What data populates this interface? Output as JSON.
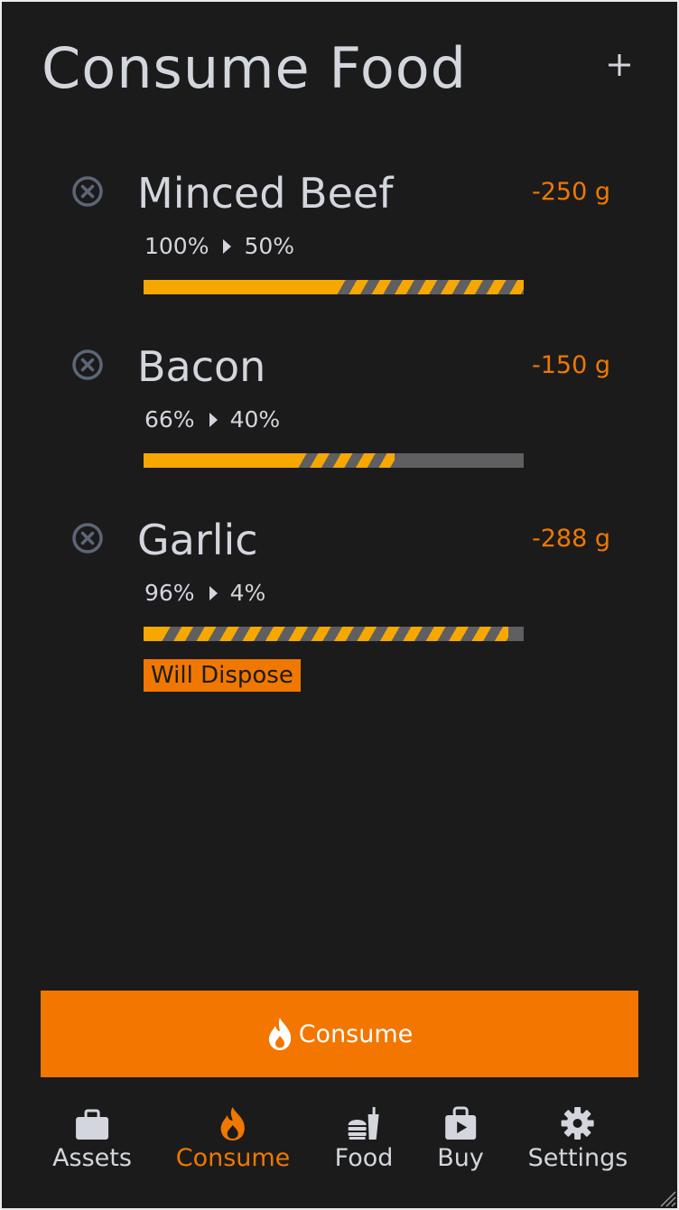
{
  "header": {
    "title": "Consume Food",
    "add_icon": "plus-icon"
  },
  "colors": {
    "accent": "#f37600",
    "amount_text": "#f07800",
    "bar_fill": "#f7a800",
    "bar_track": "#5f5f61",
    "background": "#1b1b1c"
  },
  "items": [
    {
      "name": "Minced Beef",
      "amount": "-250 g",
      "from_label": "100%",
      "to_label": "50%",
      "from": 1.0,
      "to": 0.5,
      "dispose_label": ""
    },
    {
      "name": "Bacon",
      "amount": "-150 g",
      "from_label": "66%",
      "to_label": "40%",
      "from": 0.66,
      "to": 0.4,
      "dispose_label": ""
    },
    {
      "name": "Garlic",
      "amount": "-288 g",
      "from_label": "96%",
      "to_label": "4%",
      "from": 0.96,
      "to": 0.04,
      "dispose_label": "Will Dispose"
    }
  ],
  "consume_button": {
    "label": "Consume",
    "icon": "flame-icon"
  },
  "tabs": [
    {
      "label": "Assets",
      "icon": "briefcase-icon",
      "active": false
    },
    {
      "label": "Consume",
      "icon": "flame-icon",
      "active": true
    },
    {
      "label": "Food",
      "icon": "food-icon",
      "active": false
    },
    {
      "label": "Buy",
      "icon": "shopping-bag-icon",
      "active": false
    },
    {
      "label": "Settings",
      "icon": "gear-icon",
      "active": false
    }
  ]
}
